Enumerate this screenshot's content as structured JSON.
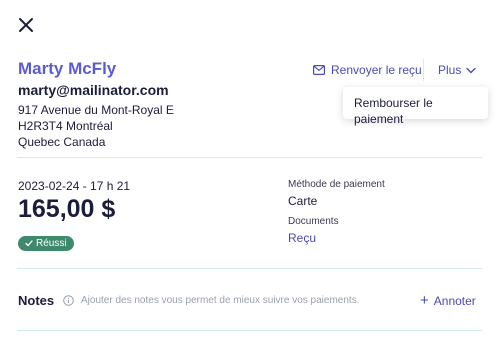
{
  "customer": {
    "name": "Marty McFly",
    "email": "marty@mailinator.com",
    "address_line1": "917 Avenue du Mont-Royal E",
    "address_line2": "H2R3T4 Montréal",
    "address_line3": "Quebec Canada"
  },
  "actions": {
    "resend_label": "Renvoyer le reçu",
    "more_label": "Plus",
    "menu_items": [
      "Rembourser le paiement"
    ]
  },
  "payment": {
    "datetime": "2023-02-24 - 17 h 21",
    "amount": "165,00 $",
    "status": "Réussi",
    "method_label": "Méthode de paiement",
    "method_value": "Carte",
    "documents_label": "Documents",
    "documents_link": "Reçu"
  },
  "notes": {
    "title": "Notes",
    "hint": "Ajouter des notes vous permet de mieux suivre vos paiements.",
    "add_label": "Annoter"
  },
  "colors": {
    "accent": "#5b5bd6",
    "link": "#4a4ab8",
    "success_badge": "#3f8a6d",
    "divider": "#cfeee4"
  },
  "icons": {
    "close": "close-icon",
    "mail": "mail-icon",
    "chevron": "chevron-down-icon",
    "check": "check-icon",
    "info": "info-icon",
    "plus": "plus-icon"
  }
}
